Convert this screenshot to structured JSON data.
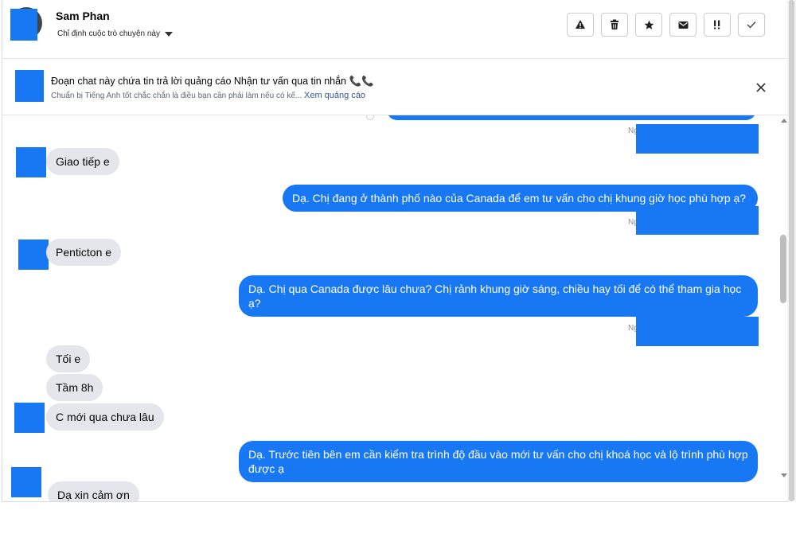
{
  "header": {
    "contact_name": "Sam Phan",
    "assign_label": "Chỉ định cuộc trò chuyện này",
    "toolbar": [
      {
        "name": "report-button",
        "icon": "warning-icon"
      },
      {
        "name": "delete-button",
        "icon": "trash-icon"
      },
      {
        "name": "star-button",
        "icon": "star-icon"
      },
      {
        "name": "mark-unread-button",
        "icon": "envelope-icon"
      },
      {
        "name": "spam-button",
        "icon": "spam-icon"
      },
      {
        "name": "mark-done-button",
        "icon": "check-icon"
      }
    ]
  },
  "ad_notice": {
    "title": "Đoạn chat này chứa tin trả lời quảng cáo Nhận tư vấn qua tin nhắn 📞📞",
    "subtitle": "Chuẩn bị Tiếng Anh tốt chắc chắn là điều bạn cần phải làm nếu có kế...",
    "link": "Xem quảng cáo"
  },
  "messages": {
    "status_1": "Ng",
    "in_1": "Giao tiếp e",
    "out_1": "Dạ. Chị đang ở thành phố nào của Canada để em tư vấn cho chị khung giờ học phù hợp ạ?",
    "status_2": "Ng",
    "in_2": "Penticton e",
    "out_2": "Dạ. Chị qua Canada được lâu chưa? Chị rảnh khung giờ sáng, chiều hay tối để có thể tham gia học ạ?",
    "status_3": "Ng",
    "in_3": "Tối e",
    "in_4": "Tầm 8h",
    "in_5": "C mới qua chưa lâu",
    "out_3": "Dạ. Trước tiên bên em cần kiểm tra trình độ đầu vào mới tư vấn cho chị khoá học và lộ trình phù hợp được ạ",
    "in_6": "Dạ xin cảm ơn"
  },
  "colors": {
    "outgoing": "#1877f2",
    "incoming": "#e4e6eb",
    "redaction": "#1877f2"
  }
}
